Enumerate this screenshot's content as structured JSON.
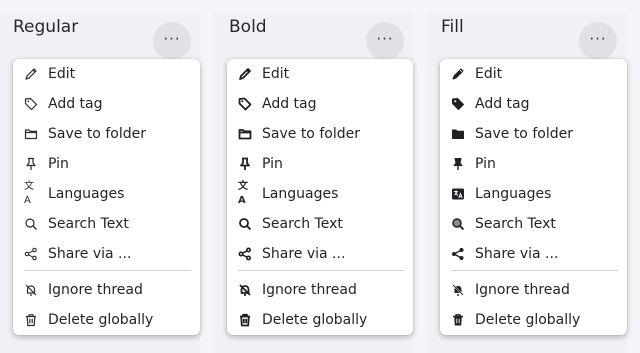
{
  "more_button_label": "···",
  "columns": [
    {
      "title": "Regular",
      "items": [
        "Edit",
        "Add tag",
        "Save to folder",
        "Pin",
        "Languages",
        "Search Text",
        "Share via ...",
        "Ignore thread",
        "Delete globally"
      ]
    },
    {
      "title": "Bold",
      "items": [
        "Edit",
        "Add tag",
        "Save to folder",
        "Pin",
        "Languages",
        "Search Text",
        "Share via ...",
        "Ignore thread",
        "Delete globally"
      ]
    },
    {
      "title": "Fill",
      "items": [
        "Edit",
        "Add tag",
        "Save to folder",
        "Pin",
        "Languages",
        "Search Text",
        "Share via ...",
        "Ignore thread",
        "Delete globally"
      ]
    }
  ],
  "icons": [
    "pencil-icon",
    "tag-icon",
    "folder-icon",
    "pin-icon",
    "language-icon",
    "search-icon",
    "share-icon",
    "bell-off-icon",
    "trash-icon"
  ],
  "colors": {
    "background": "#f4f5f8",
    "menu_background": "#ffffff",
    "text": "#222428",
    "button_background": "#dfe1e5"
  }
}
